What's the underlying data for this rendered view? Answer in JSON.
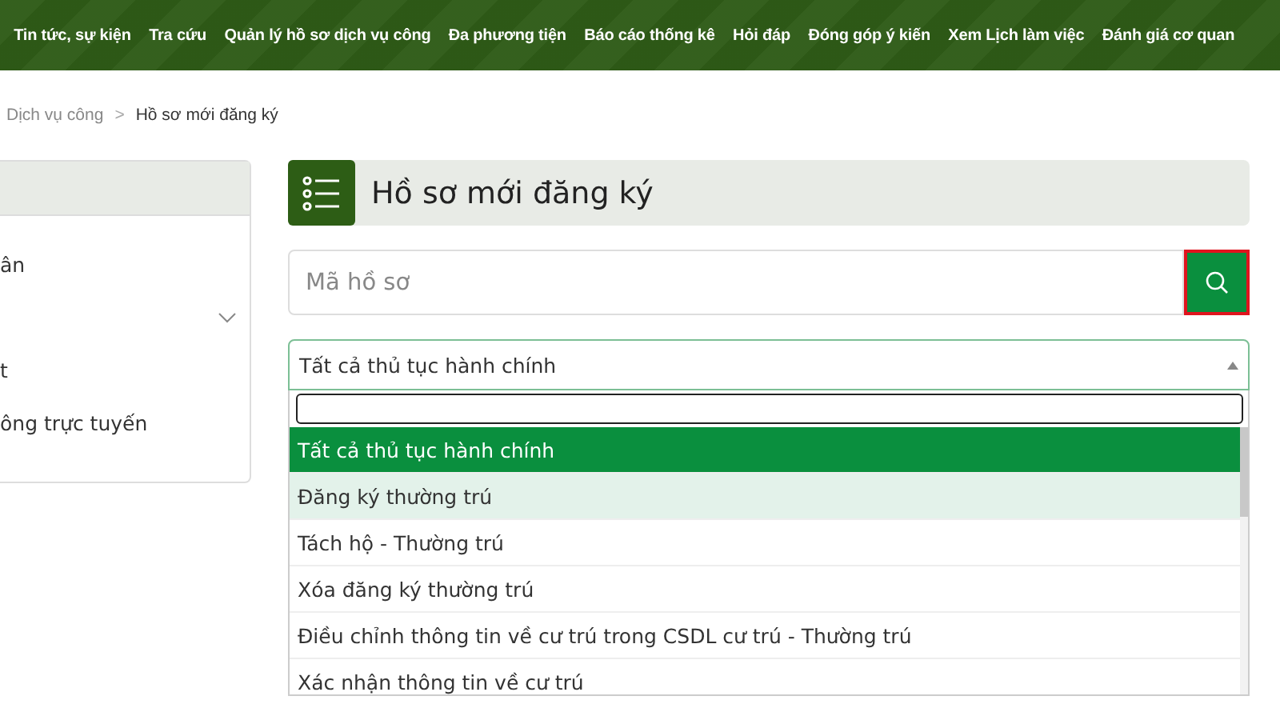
{
  "nav": {
    "items": [
      "Tin tức, sự kiện",
      "Tra cứu",
      "Quản lý hồ sơ dịch vụ công",
      "Đa phương tiện",
      "Báo cáo thống kê",
      "Hỏi đáp",
      "Đóng góp ý kiến",
      "Xem Lịch làm việc",
      "Đánh giá cơ quan"
    ]
  },
  "breadcrumb": {
    "items": [
      "Dịch vụ công",
      "Hồ sơ mới đăng ký"
    ],
    "separator": ">"
  },
  "sidebar": {
    "items": [
      {
        "label": "ân"
      },
      {
        "expanded": false
      },
      {
        "label": "t"
      },
      {
        "label": "ông trực tuyến"
      }
    ]
  },
  "page_title": "Hồ sơ mới đăng ký",
  "search": {
    "placeholder": "Mã hồ sơ"
  },
  "select": {
    "value": "Tất cả thủ tục hành chính",
    "open": true
  },
  "options": [
    {
      "label": "Tất cả thủ tục hành chính",
      "selected": true,
      "hovered": false
    },
    {
      "label": "Đăng ký thường trú",
      "selected": false,
      "hovered": true
    },
    {
      "label": "Tách hộ - Thường trú",
      "selected": false,
      "hovered": false
    },
    {
      "label": "Xóa đăng ký thường trú",
      "selected": false,
      "hovered": false
    },
    {
      "label": "Điều chỉnh thông tin về cư trú trong CSDL cư trú - Thường trú",
      "selected": false,
      "hovered": false
    },
    {
      "label": "Xác nhận thông tin về cư trú",
      "selected": false,
      "hovered": false
    }
  ]
}
